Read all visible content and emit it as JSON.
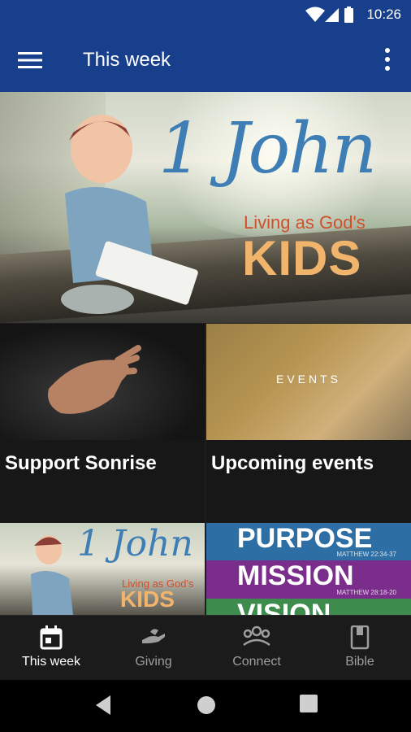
{
  "status_bar": {
    "time": "10:26"
  },
  "app_bar": {
    "title": "This week"
  },
  "hero": {
    "title_script": "1 John",
    "subtitle": "Living as God's",
    "big_word": "KIDS",
    "carousel_count": 4,
    "carousel_active": 0
  },
  "tiles": [
    {
      "label": "Support Sonrise"
    },
    {
      "label": "Upcoming events",
      "overlay": "EVENTS"
    },
    {
      "label": "",
      "title_script": "1 John",
      "subtitle": "Living as God's",
      "big_word": "KIDS"
    },
    {
      "label": "",
      "bands": [
        {
          "word": "PURPOSE",
          "ref": "MATTHEW 22:34-37",
          "color": "#2d6fa5"
        },
        {
          "word": "MISSION",
          "ref": "MATTHEW 28:18-20",
          "color": "#7a2d8a"
        },
        {
          "word": "VISION",
          "ref": "",
          "color": "#3d8c4d"
        }
      ]
    }
  ],
  "bottom_nav": [
    {
      "label": "This week",
      "icon": "calendar-icon",
      "active": true
    },
    {
      "label": "Giving",
      "icon": "giving-hand-icon",
      "active": false
    },
    {
      "label": "Connect",
      "icon": "group-icon",
      "active": false
    },
    {
      "label": "Bible",
      "icon": "bible-icon",
      "active": false
    }
  ],
  "colors": {
    "primary": "#173f8c",
    "nav_active": "#ffffff",
    "nav_inactive": "#9e9e9e",
    "script_blue": "#3f7eb5",
    "accent_orange": "#d0502c",
    "kids_yellow": "#f1b46c"
  }
}
